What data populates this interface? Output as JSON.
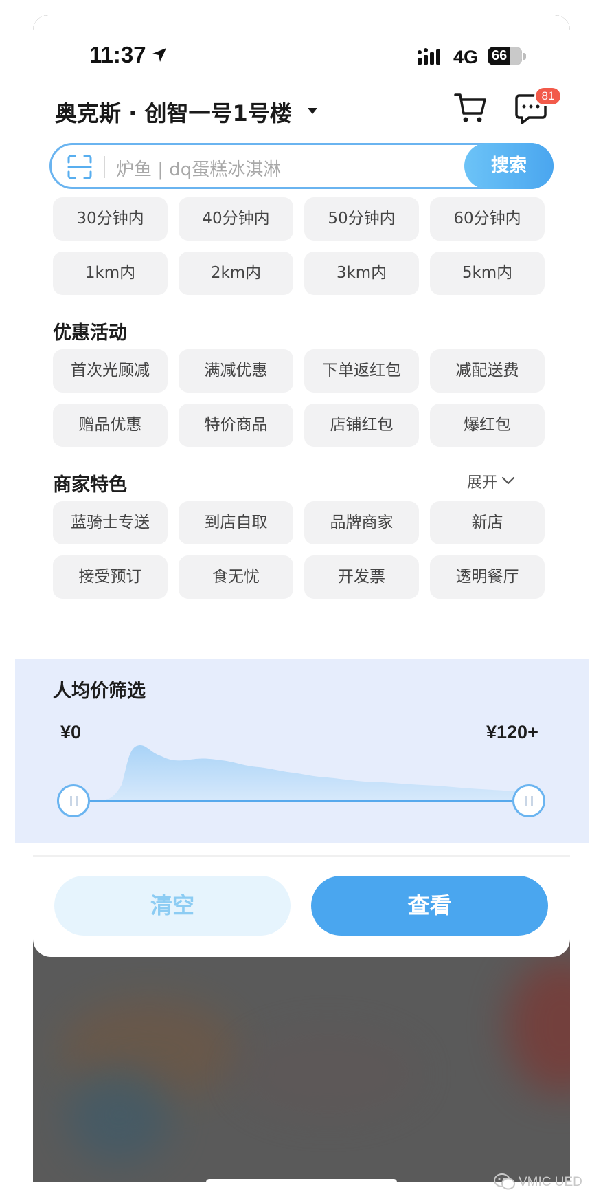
{
  "status_bar": {
    "time": "11:37",
    "network": "4G",
    "battery": "66",
    "battery_level_percent": 66
  },
  "header": {
    "location": "奥克斯 · 创智一号1号楼",
    "message_badge": "81",
    "icons": [
      "cart-icon",
      "message-icon",
      "location-arrow-icon"
    ]
  },
  "search": {
    "placeholder": "炉鱼 | dq蛋糕冰淇淋",
    "button_label": "搜索",
    "scan_icon": "scan-icon"
  },
  "delivery_filters": {
    "time": [
      "30分钟内",
      "40分钟内",
      "50分钟内",
      "60分钟内"
    ],
    "distance": [
      "1km内",
      "2km内",
      "3km内",
      "5km内"
    ]
  },
  "promotions": {
    "title": "优惠活动",
    "items": [
      "首次光顾减",
      "满减优惠",
      "下单返红包",
      "减配送费",
      "赠品优惠",
      "特价商品",
      "店铺红包",
      "爆红包"
    ]
  },
  "merchant_features": {
    "title": "商家特色",
    "expand_label": "展开",
    "items": [
      "蓝骑士专送",
      "到店自取",
      "品牌商家",
      "新店",
      "接受预订",
      "食无忧",
      "开发票",
      "透明餐厅"
    ]
  },
  "price_filter": {
    "title": "人均价筛选",
    "min_label": "¥0",
    "max_label": "¥120+",
    "range_selected": [
      0,
      120
    ]
  },
  "actions": {
    "clear_label": "清空",
    "view_label": "查看"
  },
  "watermark": {
    "text": "VMIC UED"
  },
  "colors": {
    "accent": "#4aa6ef",
    "badge": "#f25a4a",
    "chip_bg": "#f2f2f3",
    "overlay": "#5a5a5a"
  }
}
